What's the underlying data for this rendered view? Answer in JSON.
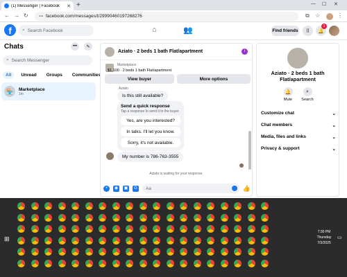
{
  "browser": {
    "tab_title": "(1) Messenger | Facebook",
    "new_tab": "+",
    "url": "facebook.com/messages/t/29990460197268276"
  },
  "fb": {
    "logo": "f",
    "search_placeholder": "Search Facebook",
    "find_friends": "Find friends",
    "notification_count": "1"
  },
  "left": {
    "title": "Chats",
    "search_placeholder": "Search Messenger",
    "filters": [
      "All",
      "Unread",
      "Groups",
      "Communities"
    ],
    "conversation": {
      "name": "Marketplace",
      "time": "1m"
    }
  },
  "thread": {
    "title": "Aziato · 2 beds 1 bath Flat/apartment",
    "listing_source": "Marketplace",
    "listing_price": "$1,100 · 2 beds 1 bath Flat/apartment",
    "view_buyer": "View buyer",
    "more_options": "More options",
    "sender_small": "Aziato",
    "msg_available": "Is this still available?",
    "quick_title": "Send a quick response",
    "quick_sub": "Tap a response to send it to the buyer.",
    "quick_replies": [
      "Yes, are you interested?",
      "In talks. I'll let you know.",
      "Sorry, it's not available."
    ],
    "msg_number": "My number is 786-763-3555",
    "waiting": "Aziato is waiting for your response.",
    "composer_placeholder": "Aa"
  },
  "right": {
    "title": "Aziato · 2 beds 1 bath Flat/apartment",
    "mute": "Mute",
    "search": "Search",
    "rows": [
      "Customize chat",
      "Chat members",
      "Media, files and links",
      "Privacy & support"
    ]
  },
  "taskbar": {
    "time": "7:30 PM",
    "day": "Thursday",
    "date": "7/3/2025"
  }
}
